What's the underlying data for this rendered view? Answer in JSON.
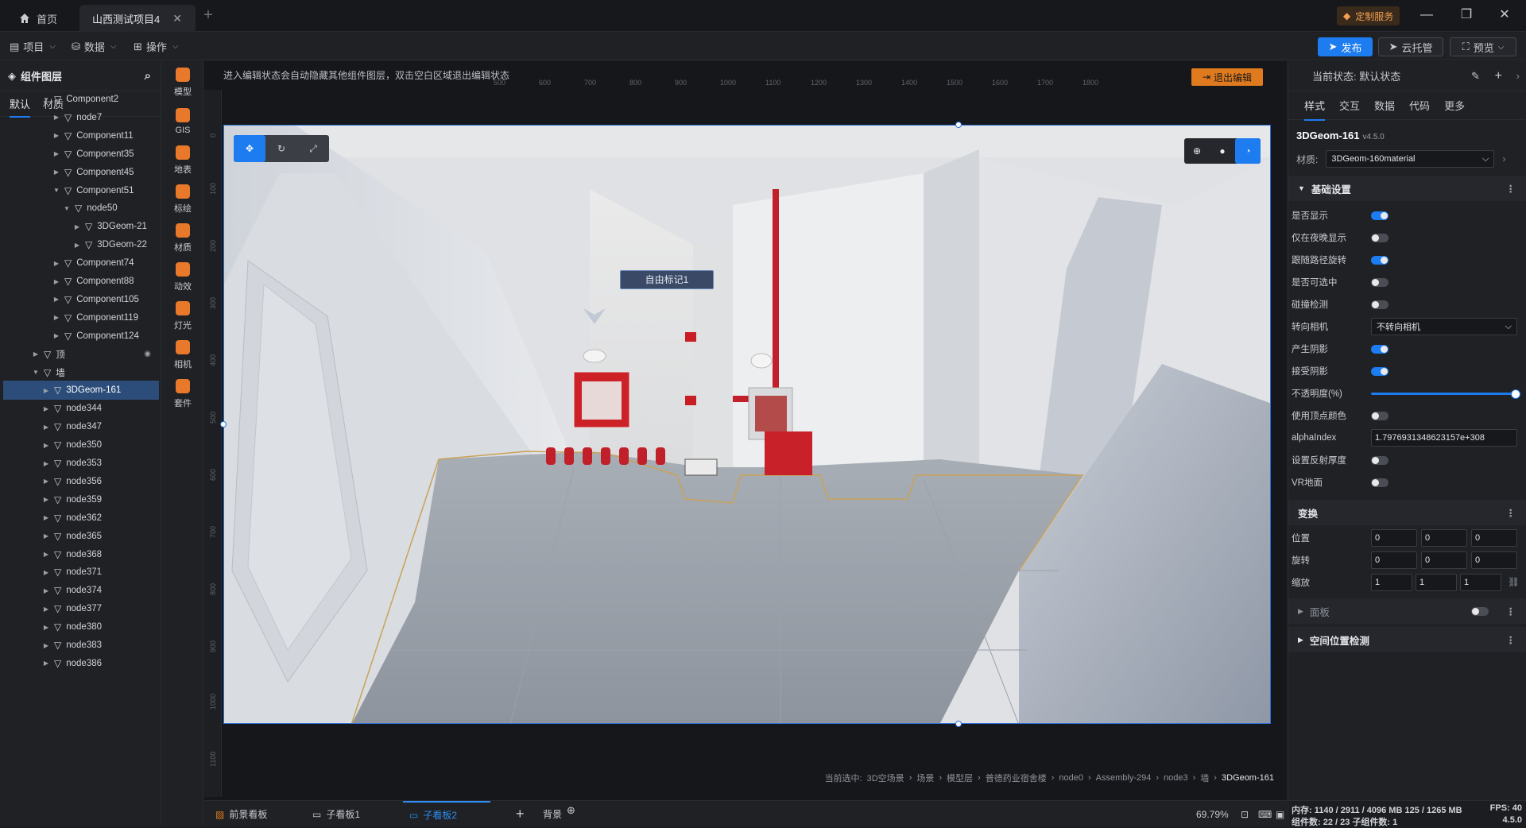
{
  "titlebar": {
    "home_label": "首页",
    "project_tab": "山西测试项目4",
    "custom_service": "定制服务"
  },
  "menubar": {
    "project": "项目",
    "data": "数据",
    "operate": "操作",
    "publish": "发布",
    "cloud": "云托管",
    "preview": "预览"
  },
  "layers": {
    "title": "组件图层",
    "tabs": [
      "默认",
      "材质"
    ],
    "tree": [
      {
        "label": "Component2",
        "level": 4,
        "open": true
      },
      {
        "label": "node7",
        "level": 5,
        "open": false
      },
      {
        "label": "Component11",
        "level": 5,
        "open": false
      },
      {
        "label": "Component35",
        "level": 5,
        "open": false
      },
      {
        "label": "Component45",
        "level": 5,
        "open": false
      },
      {
        "label": "Component51",
        "level": 5,
        "open": true
      },
      {
        "label": "node50",
        "level": 6,
        "open": true
      },
      {
        "label": "3DGeom-21",
        "level": 7,
        "open": false
      },
      {
        "label": "3DGeom-22",
        "level": 7,
        "open": false
      },
      {
        "label": "Component74",
        "level": 5,
        "open": false
      },
      {
        "label": "Component88",
        "level": 5,
        "open": false
      },
      {
        "label": "Component105",
        "level": 5,
        "open": false
      },
      {
        "label": "Component119",
        "level": 5,
        "open": false
      },
      {
        "label": "Component124",
        "level": 5,
        "open": false
      },
      {
        "label": "顶",
        "level": 3,
        "open": false
      },
      {
        "label": "墙",
        "level": 3,
        "open": true
      },
      {
        "label": "3DGeom-161",
        "level": 4,
        "open": false,
        "selected": true
      },
      {
        "label": "node344",
        "level": 4,
        "open": false
      },
      {
        "label": "node347",
        "level": 4,
        "open": false
      },
      {
        "label": "node350",
        "level": 4,
        "open": false
      },
      {
        "label": "node353",
        "level": 4,
        "open": false
      },
      {
        "label": "node356",
        "level": 4,
        "open": false
      },
      {
        "label": "node359",
        "level": 4,
        "open": false
      },
      {
        "label": "node362",
        "level": 4,
        "open": false
      },
      {
        "label": "node365",
        "level": 4,
        "open": false
      },
      {
        "label": "node368",
        "level": 4,
        "open": false
      },
      {
        "label": "node371",
        "level": 4,
        "open": false
      },
      {
        "label": "node374",
        "level": 4,
        "open": false
      },
      {
        "label": "node377",
        "level": 4,
        "open": false
      },
      {
        "label": "node380",
        "level": 4,
        "open": false
      },
      {
        "label": "node383",
        "level": 4,
        "open": false
      },
      {
        "label": "node386",
        "level": 4,
        "open": false
      }
    ]
  },
  "iconbar": [
    {
      "label": "模型",
      "icon": "model-icon",
      "color": "#e8782a"
    },
    {
      "label": "GIS",
      "icon": "globe-icon",
      "color": "#e8782a"
    },
    {
      "label": "地表",
      "icon": "terrain-icon",
      "color": "#e8782a"
    },
    {
      "label": "标绘",
      "icon": "pin-icon",
      "color": "#e8782a"
    },
    {
      "label": "材质",
      "icon": "material-icon",
      "color": "#e8782a"
    },
    {
      "label": "动效",
      "icon": "star-icon",
      "color": "#e8782a"
    },
    {
      "label": "灯光",
      "icon": "light-icon",
      "color": "#e8782a"
    },
    {
      "label": "相机",
      "icon": "camera-icon",
      "color": "#e8782a"
    },
    {
      "label": "套件",
      "icon": "kit-icon",
      "color": "#e8782a"
    }
  ],
  "editor": {
    "hint": "进入编辑状态会自动隐藏其他组件图层，双击空白区域退出编辑状态",
    "exit_label": "退出编辑",
    "ruler_h": [
      "500",
      "600",
      "700",
      "800",
      "900",
      "1000",
      "1100",
      "1200",
      "1300",
      "1400",
      "1500",
      "1600",
      "1700",
      "1800"
    ],
    "ruler_v": [
      "0",
      "100",
      "200",
      "300",
      "400",
      "500",
      "600",
      "700",
      "800",
      "900",
      "1000",
      "1100"
    ],
    "marker_label": "自由标记1",
    "breadcrumb": [
      "当前选中:",
      "3D空场景",
      "›",
      "场景",
      "›",
      "模型层",
      "›",
      "普德药业宿舍楼",
      "›",
      "node0",
      "›",
      "Assembly-294",
      "›",
      "node3",
      "›",
      "墙",
      "›"
    ],
    "breadcrumb_last": "3DGeom-161"
  },
  "bottombar": {
    "tabs": [
      "前景看板",
      "子看板1",
      "子看板2"
    ],
    "background": "背景",
    "zoom": "69.79%"
  },
  "props": {
    "state_label": "当前状态: 默认状态",
    "tabs": [
      "样式",
      "交互",
      "数据",
      "代码",
      "更多"
    ],
    "object_name": "3DGeom-161",
    "object_version": "v4.5.0",
    "material_label": "材质:",
    "material_value": "3DGeom-160material",
    "basic_section": "基础设置",
    "rows": {
      "visible": {
        "label": "是否显示",
        "on": true
      },
      "night": {
        "label": "仅在夜晚显示",
        "on": false
      },
      "follow_path": {
        "label": "跟随路径旋转",
        "on": true
      },
      "selectable": {
        "label": "是否可选中",
        "on": false
      },
      "collision": {
        "label": "碰撞检测",
        "on": false
      },
      "face_camera": {
        "label": "转向相机",
        "value": "不转向相机"
      },
      "cast_shadow": {
        "label": "产生阴影",
        "on": true
      },
      "receive_shadow": {
        "label": "接受阴影",
        "on": true
      },
      "opacity": {
        "label": "不透明度(%)",
        "value": 100
      },
      "vertex_color": {
        "label": "使用顶点颜色",
        "on": false
      },
      "alpha_index": {
        "label": "alphaIndex",
        "value": "1.7976931348623157e+308"
      },
      "reflect": {
        "label": "设置反射厚度",
        "on": false
      },
      "vr_ground": {
        "label": "VR地面",
        "on": false
      }
    },
    "transform_section": "变换",
    "position": {
      "label": "位置",
      "values": [
        "0",
        "0",
        "0"
      ]
    },
    "rotation": {
      "label": "旋转",
      "values": [
        "0",
        "0",
        "0"
      ]
    },
    "scale": {
      "label": "缩放",
      "values": [
        "1",
        "1",
        "1"
      ]
    },
    "panel_section": "面板",
    "space_section": "空间位置检测",
    "status_mem": "内存: 1140 / 2911 / 4096 MB 125 / 1265 MB",
    "status_fps": "FPS: 40",
    "status_comp": "组件数: 22 / 23   子组件数: 1",
    "status_ver": "4.5.0"
  }
}
